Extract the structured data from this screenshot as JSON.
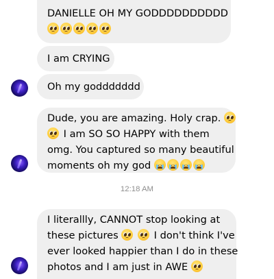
{
  "conversation": {
    "messages": [
      {
        "lines": [
          {
            "text": "DANIELLE OH MY GODDDDDDDDDD",
            "emoji_after": []
          },
          {
            "text": "",
            "emoji_after": [
              "pleading-face-emoji",
              "pleading-face-emoji",
              "pleading-face-emoji",
              "pleading-face-emoji",
              "pleading-face-emoji"
            ]
          }
        ]
      },
      {
        "lines": [
          {
            "text": "I am CRYING"
          }
        ]
      },
      {
        "lines": [
          {
            "text": "Oh my goddddddd"
          }
        ]
      },
      {
        "lines": [
          {
            "text": "Dude, you are amazing. Holy crap."
          },
          {
            "text": "I am SO SO HAPPY with them"
          },
          {
            "text": "omg. You captured so many beautiful"
          },
          {
            "text": "moments oh my god"
          }
        ]
      },
      {
        "lines": [
          {
            "text": "I literallly, CANNOT stop looking at"
          },
          {
            "text": "these pictures"
          },
          {
            "text": "I don't think I've"
          },
          {
            "text": "ever looked happier than I do in these"
          },
          {
            "text": "photos and I am just in AWE"
          }
        ]
      }
    ],
    "timestamp": "12:18 AM"
  },
  "colors": {
    "bubble_background": "#efefef",
    "timestamp_text": "#8e8e8e",
    "message_text": "#000000"
  },
  "icons": {
    "pleading": "pleading-face-emoji",
    "crying": "loudly-crying-face-emoji",
    "avatar": "contact-avatar"
  }
}
